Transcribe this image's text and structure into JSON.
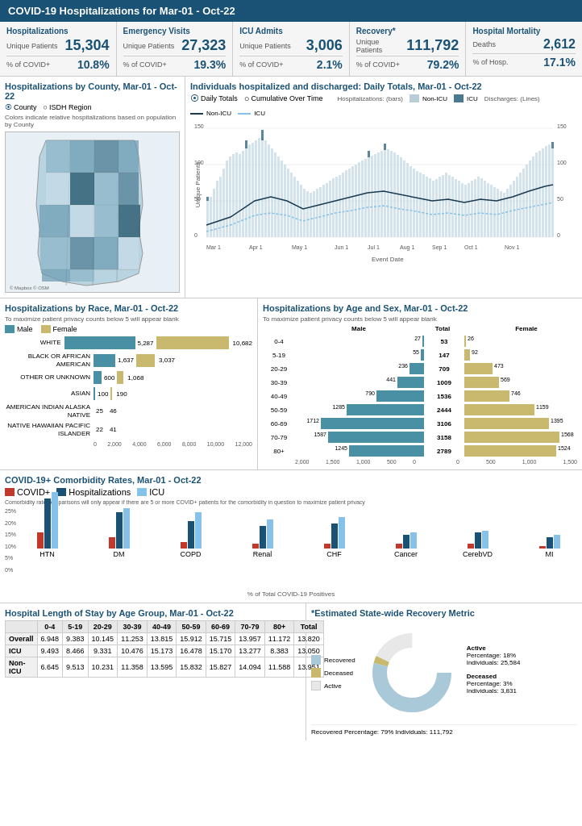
{
  "header": {
    "title": "COVID-19 Hospitalizations for Mar-01 - Oct-22"
  },
  "stats": [
    {
      "title": "Hospitalizations",
      "unique_label": "Unique Patients",
      "unique_value": "15,304",
      "pct_label": "% of COVID+",
      "pct_value": "10.8%"
    },
    {
      "title": "Emergency Visits",
      "unique_label": "Unique Patients",
      "unique_value": "27,323",
      "pct_label": "% of COVID+",
      "pct_value": "19.3%"
    },
    {
      "title": "ICU Admits",
      "unique_label": "Unique Patients",
      "unique_value": "3,006",
      "pct_label": "% of COVID+",
      "pct_value": "2.1%"
    },
    {
      "title": "Recovery*",
      "unique_label": "Unique Patients",
      "unique_value": "111,792",
      "pct_label": "% of COVID+",
      "pct_value": "79.2%"
    },
    {
      "title": "Hospital Mortality",
      "unique_label": "Deaths",
      "unique_value": "2,612",
      "pct_label": "% of Hosp.",
      "pct_value": "17.1%"
    }
  ],
  "map_section": {
    "title": "Hospitalizations by County, Mar-01 - Oct-22",
    "radio1": "County",
    "radio2": "ISDH Region",
    "legend_text": "Colors indicate relative hospitalizations based on population by County"
  },
  "discharge_section": {
    "title": "Individuals hospitalized and discharged: Daily Totals, Mar-01 - Oct-22",
    "radio1": "Daily Totals",
    "radio2": "Cumulative Over Time",
    "hosp_label": "Hospitalizations: (bars)",
    "disc_label": "Discharges: (Lines)",
    "non_icu_label": "Non-ICU",
    "icu_label": "ICU",
    "x_label": "Event Date",
    "y_label": "Unique Patients",
    "x_ticks": [
      "Mar 1",
      "Apr 1",
      "May 1",
      "Jun 1",
      "Jul 1",
      "Aug 1",
      "Sep 1",
      "Oct 1",
      "Nov 1"
    ]
  },
  "race_section": {
    "title": "Hospitalizations by Race, Mar-01 - Oct-22",
    "subtitle": "To maximize patient privacy counts below 5 will appear blank",
    "legend_male": "Male",
    "legend_female": "Female",
    "rows": [
      {
        "label": "WHITE",
        "male": 5287,
        "female": 5395,
        "total": 10682,
        "max": 6000
      },
      {
        "label": "BLACK OR AFRICAN AMERICAN",
        "male": 1637,
        "female": 1400,
        "total": 3037,
        "max": 6000
      },
      {
        "label": "OTHER OR UNKNOWN",
        "male": 600,
        "female": 468,
        "total": 1068,
        "max": 6000
      },
      {
        "label": "ASIAN",
        "male": 100,
        "female": 90,
        "total": 190,
        "max": 6000
      },
      {
        "label": "AMERICAN INDIAN ALASKA NATIVE",
        "male": 25,
        "female": 21,
        "total": 46,
        "max": 6000
      },
      {
        "label": "NATIVE HAWAIIAN PACIFIC ISLANDER",
        "male": 22,
        "female": 19,
        "total": 41,
        "max": 6000
      }
    ]
  },
  "age_section": {
    "title": "Hospitalizations by Age and Sex, Mar-01 - Oct-22",
    "subtitle": "To maximize patient privacy counts below 5 will appear blank",
    "legend_male": "Male",
    "legend_female": "Female",
    "total_label": "Total",
    "rows": [
      {
        "age": "0-4",
        "male": 27,
        "female": 26,
        "total": 53
      },
      {
        "age": "5-19",
        "male": 55,
        "female": 92,
        "total": 147
      },
      {
        "age": "20-29",
        "male": 236,
        "female": 473,
        "total": 709
      },
      {
        "age": "30-39",
        "male": 441,
        "female": 569,
        "total": 1009
      },
      {
        "age": "40-49",
        "male": 790,
        "female": 746,
        "total": 1536
      },
      {
        "age": "50-59",
        "male": 1285,
        "female": 1159,
        "total": 2444
      },
      {
        "age": "60-69",
        "male": 1712,
        "female": 1395,
        "total": 3106
      },
      {
        "age": "70-79",
        "male": 1587,
        "female": 1568,
        "total": 3158
      },
      {
        "age": "80+",
        "male": 1245,
        "female": 1524,
        "total": 2789
      }
    ]
  },
  "comorbidity_section": {
    "title": "COVID-19+ Comorbidity Rates, Mar-01 - Oct-22",
    "legend_covid": "COVID+",
    "legend_hosp": "Hospitalizations",
    "legend_icu": "ICU",
    "subtitle": "Comorbidity rate comparisons will only appear if there are 5 or more COVID+ patients for the comorbidity in question to maximize patient privacy",
    "y_label": "% of Total COVID-19 Positives",
    "categories": [
      {
        "name": "HTN",
        "covid": 7,
        "hosp": 22,
        "icu": 25
      },
      {
        "name": "DM",
        "covid": 5,
        "hosp": 16,
        "icu": 18
      },
      {
        "name": "COPD",
        "covid": 3,
        "hosp": 12,
        "icu": 16
      },
      {
        "name": "Renal",
        "covid": 2,
        "hosp": 10,
        "icu": 13
      },
      {
        "name": "CHF",
        "covid": 2,
        "hosp": 11,
        "icu": 14
      },
      {
        "name": "Cancer",
        "covid": 2,
        "hosp": 6,
        "icu": 7
      },
      {
        "name": "CerebVD",
        "covid": 2,
        "hosp": 7,
        "icu": 8
      },
      {
        "name": "MI",
        "covid": 1,
        "hosp": 5,
        "icu": 6
      }
    ]
  },
  "los_section": {
    "title": "Hospital Length of Stay by Age Group, Mar-01 - Oct-22",
    "columns": [
      "0-4",
      "5-19",
      "20-29",
      "30-39",
      "40-49",
      "50-59",
      "60-69",
      "70-79",
      "80+",
      "Total"
    ],
    "rows": [
      {
        "label": "Overall",
        "values": [
          "6.948",
          "9.383",
          "10.145",
          "11.253",
          "13.815",
          "15.912",
          "15.715",
          "13.957",
          "11.172",
          "13.820"
        ]
      },
      {
        "label": "ICU",
        "values": [
          "9.493",
          "8.466",
          "9.331",
          "10.476",
          "15.173",
          "16.478",
          "15.170",
          "13.277",
          "8.383",
          "13.050"
        ]
      },
      {
        "label": "Non-ICU",
        "values": [
          "6.645",
          "9.513",
          "10.231",
          "11.358",
          "13.595",
          "15.832",
          "15.827",
          "14.094",
          "11.588",
          "13.951"
        ]
      }
    ]
  },
  "recovery_section": {
    "title": "*Estimated State-wide Recovery Metric",
    "donut": {
      "recovered_pct": 79,
      "deceased_pct": 3,
      "active_pct": 18
    },
    "recovered_label": "Recovered",
    "deceased_label": "Deceased",
    "active_label": "Active",
    "recovered_color": "#aac9d8",
    "deceased_color": "#c8b96e",
    "active_color": "#f5f5f5",
    "active_pct_text": "Active",
    "active_percentage": "18%",
    "active_individuals": "25,584",
    "deceased_percentage": "3%",
    "deceased_individuals": "3,831",
    "recovered_percentage": "79%",
    "recovered_individuals": "111,792"
  }
}
